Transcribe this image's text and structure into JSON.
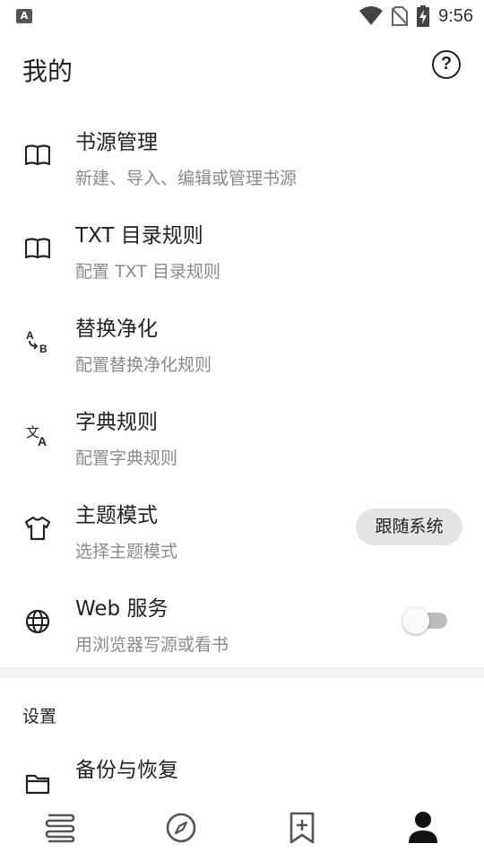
{
  "status_bar": {
    "time": "9:56",
    "app_icon_letter": "A",
    "icons": [
      "wifi-icon",
      "no-sim-icon",
      "battery-charging-icon"
    ]
  },
  "header": {
    "title": "我的",
    "help_icon": "help-circle-icon",
    "help_glyph": "?"
  },
  "menu": [
    {
      "icon": "book-open-icon",
      "title": "书源管理",
      "subtitle": "新建、导入、编辑或管理书源"
    },
    {
      "icon": "book-open-icon",
      "title": "TXT 目录规则",
      "subtitle": "配置 TXT 目录规则"
    },
    {
      "icon": "replace-ab-icon",
      "title": "替换净化",
      "subtitle": "配置替换净化规则"
    },
    {
      "icon": "translate-icon",
      "title": "字典规则",
      "subtitle": "配置字典规则"
    },
    {
      "icon": "tshirt-icon",
      "title": "主题模式",
      "subtitle": "选择主题模式",
      "value": "跟随系统"
    },
    {
      "icon": "globe-icon",
      "title": "Web 服务",
      "subtitle": "用浏览器写源或看书",
      "toggle_on": false
    }
  ],
  "settings_section": {
    "title": "设置",
    "items": [
      {
        "icon": "folder-icon",
        "title": "备份与恢复"
      }
    ]
  },
  "bottom_nav": [
    {
      "icon": "bookshelf-icon",
      "active": false
    },
    {
      "icon": "compass-icon",
      "active": false
    },
    {
      "icon": "bookmark-add-icon",
      "active": false
    },
    {
      "icon": "person-icon",
      "active": true
    }
  ],
  "colors": {
    "text_primary": "#222222",
    "text_secondary": "#8a8a8a",
    "chip_bg": "#e4e4e4",
    "toggle_off_track": "#bdbdbd"
  }
}
